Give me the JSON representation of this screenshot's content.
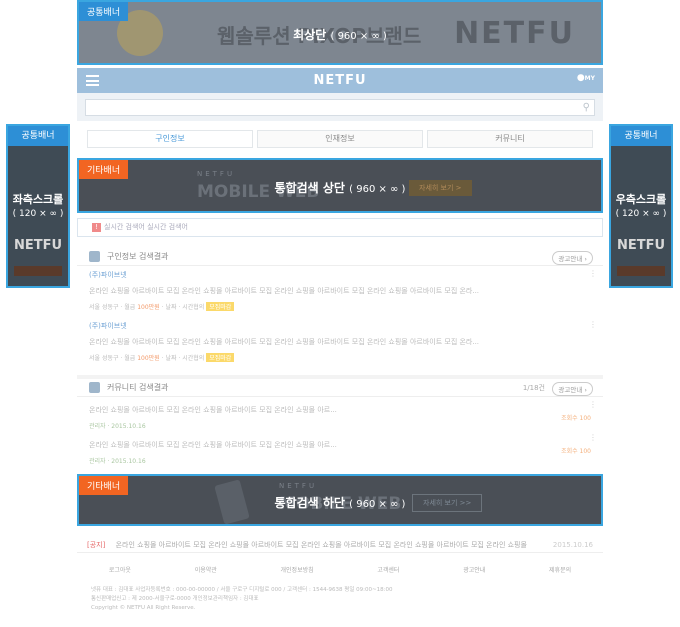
{
  "top_banner": {
    "tag": "공통배너",
    "label": "최상단",
    "size": "( 960 × ∞ )",
    "bg_text": "웹솔루션 PIXOP브랜드",
    "bg_brand": "NETFU"
  },
  "left_banner": {
    "tag": "공통배너",
    "label": "좌측스크롤",
    "size": "( 120 × ∞ )",
    "brand": "NETFU"
  },
  "right_banner": {
    "tag": "공통배너",
    "label": "우측스크롤",
    "size": "( 120 × ∞ )",
    "brand": "NETFU"
  },
  "header": {
    "title": "NETFU",
    "my_label": "MY"
  },
  "tabs": [
    {
      "label": "구인정보"
    },
    {
      "label": "인재정보"
    },
    {
      "label": "커뮤니티"
    }
  ],
  "middle_banner": {
    "tag": "기타배너",
    "label": "통합검색 상단",
    "size": "( 960 × ∞ )",
    "bg_small": "NETFU",
    "bg_big": "MOBILE WEB",
    "bg_btn": "자세히 보기 >"
  },
  "alert": {
    "text": "실시간 검색어 실시간 검색어"
  },
  "job_section": {
    "title": "구인정보 검색결과",
    "ad_btn": "광고안내 ›",
    "items": [
      {
        "company": "(주)파이브넷",
        "desc": "온라인 쇼핑몰 아르바이트 모집 온라인 쇼핑몰 아르바이트 모집 온라인 쇼핑몰 아르바이트 모집 온라인 쇼핑몰 아르바이트 모집 온라...",
        "loc": "서울 성동구 · 월급",
        "pay": "100만원",
        "etc": "· 날짜 · 시간협의",
        "badge": "모집마감"
      },
      {
        "company": "(주)파이브넷",
        "desc": "온라인 쇼핑몰 아르바이트 모집 온라인 쇼핑몰 아르바이트 모집 온라인 쇼핑몰 아르바이트 모집 온라인 쇼핑몰 아르바이트 모집 온라...",
        "loc": "서울 성동구 · 월급",
        "pay": "100만원",
        "etc": "· 날짜 · 시간협의",
        "badge": "모집마감"
      }
    ]
  },
  "community_section": {
    "title": "커뮤니티 검색결과",
    "count": "1/18건",
    "ad_btn": "광고안내 ›",
    "items": [
      {
        "desc": "온라인 쇼핑몰 아르바이트 모집 온라인 쇼핑몰 아르바이트 모집 온라인 쇼핑몰 아르...",
        "meta": "관리자 · 2015.10.16",
        "view": "조회수 100"
      },
      {
        "desc": "온라인 쇼핑몰 아르바이트 모집 온라인 쇼핑몰 아르바이트 모집 온라인 쇼핑몰 아르...",
        "meta": "관리자 · 2015.10.16",
        "view": "조회수 100"
      }
    ]
  },
  "bottom_banner": {
    "tag": "기타배너",
    "label": "통합검색 하단",
    "size": "( 960 × ∞ )",
    "bg_small": "NETFU",
    "bg_big": "MOBILE WEB",
    "bg_btn": "자세히 보기 >>"
  },
  "notice": {
    "label": "[공지]",
    "text": "온라인 쇼핑몰 아르바이트 모집 온라인 쇼핑몰 아르바이트 모집 온라인 쇼핑몰 아르바이트 모집 온라인 쇼핑몰 아르바이트 모집 온라인 쇼핑몰",
    "date": "2015.10.16"
  },
  "footer": {
    "links": [
      "로그아웃",
      "이용약관",
      "개인정보방침",
      "고객센터",
      "광고안내",
      "제휴문의"
    ],
    "info1": "넷퓨 대표 : 김대표 사업자등록번호 : 000-00-00000 / 서울 구로구 디지털로 000 / 고객센터 : 1544-9638 평일 09:00~18:00",
    "info2": "통신판매업신고 : 제 2000-서울구로-0000 개인정보관리책임자 : 김대표",
    "copy": "Copyright © NETFU All Right Reserve."
  }
}
